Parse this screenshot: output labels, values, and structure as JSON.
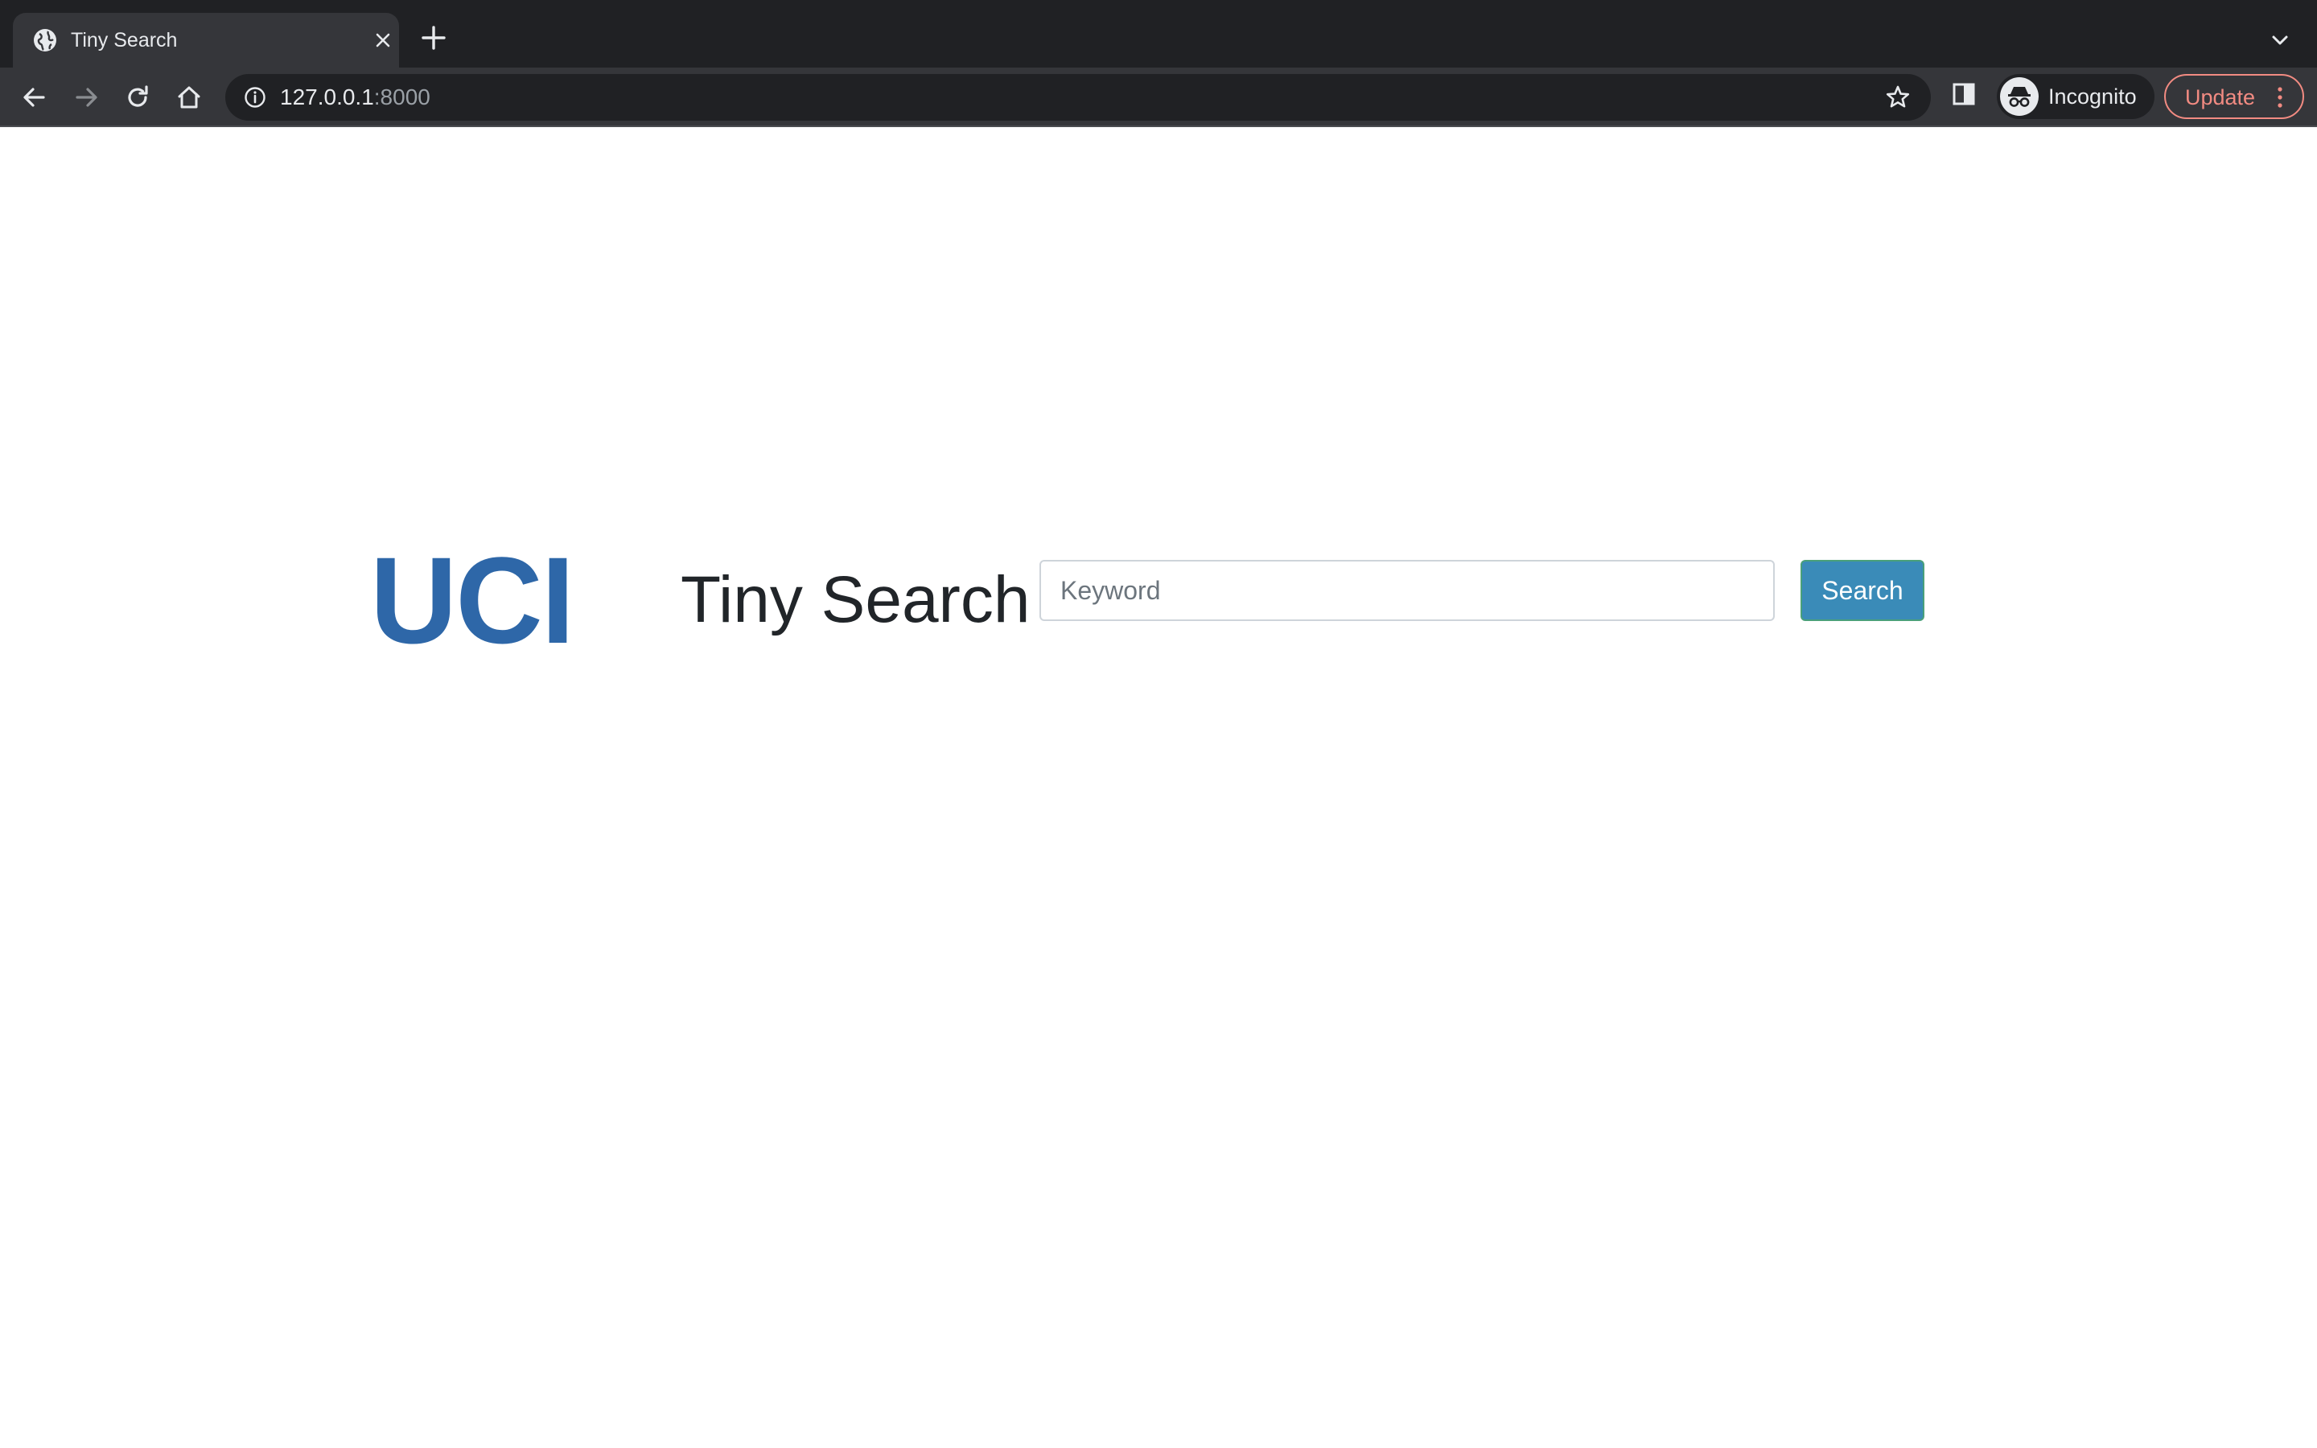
{
  "browser": {
    "tab": {
      "title": "Tiny Search",
      "favicon": "globe-icon"
    },
    "omnibox": {
      "url_host": "127.0.0.1",
      "url_port": ":8000"
    },
    "profile": {
      "label": "Incognito",
      "icon": "incognito-icon"
    },
    "update_button": {
      "label": "Update"
    },
    "colors": {
      "tabstrip_bg": "#202124",
      "toolbar_bg": "#35363a",
      "update_accent": "#f28b82"
    }
  },
  "page": {
    "logo_text": "UCI",
    "title": "Tiny Search",
    "search": {
      "placeholder": "Keyword",
      "value": "",
      "button_label": "Search"
    },
    "colors": {
      "logo": "#2e67a8",
      "button_bg": "#3a8bb8",
      "text": "#212529"
    }
  }
}
